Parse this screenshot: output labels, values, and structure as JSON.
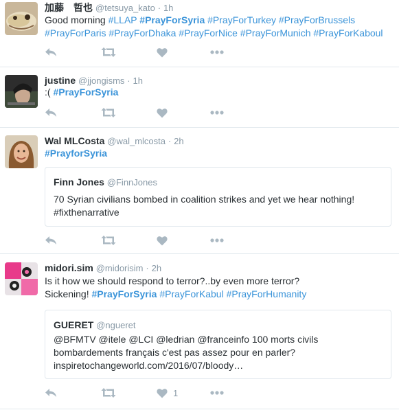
{
  "tweets": [
    {
      "name": "加藤　哲也",
      "handle": "@tetsuya_kato",
      "dot": "·",
      "time": "1h",
      "lines": [
        [
          {
            "t": "Good morning ",
            "k": "txt"
          },
          {
            "t": "#LLAP",
            "k": "tag"
          },
          {
            "t": " ",
            "k": "txt"
          },
          {
            "t": "#PrayForSyria",
            "k": "tagb"
          },
          {
            "t": " ",
            "k": "txt"
          },
          {
            "t": "#PrayForTurkey",
            "k": "tag"
          },
          {
            "t": " ",
            "k": "txt"
          },
          {
            "t": "#PrayForBrussels",
            "k": "tag"
          }
        ],
        [
          {
            "t": "#PrayForParis",
            "k": "tag"
          },
          {
            "t": " ",
            "k": "txt"
          },
          {
            "t": "#PrayForDhaka",
            "k": "tag"
          },
          {
            "t": " ",
            "k": "txt"
          },
          {
            "t": "#PrayForNice",
            "k": "tag"
          },
          {
            "t": " ",
            "k": "txt"
          },
          {
            "t": "#PrayForMunich",
            "k": "tag"
          },
          {
            "t": " ",
            "k": "txt"
          },
          {
            "t": "#PrayForKaboul",
            "k": "tag"
          }
        ]
      ],
      "like_count": ""
    },
    {
      "name": "justine",
      "handle": "@jjongisms",
      "dot": "·",
      "time": "1h",
      "lines": [
        [
          {
            "t": ":( ",
            "k": "txt"
          },
          {
            "t": "#PrayForSyria",
            "k": "tagb"
          }
        ]
      ],
      "like_count": ""
    },
    {
      "name": "Wal MLCosta",
      "handle": "@wal_mlcosta",
      "dot": "·",
      "time": "2h",
      "lines": [
        [
          {
            "t": "#PrayforSyria",
            "k": "tagb"
          }
        ]
      ],
      "quote": {
        "name": "Finn Jones",
        "handle": "@FinnJones",
        "lines": [
          "70 Syrian civilians bombed in coalition strikes and yet we hear nothing!",
          "#fixthenarrative"
        ]
      },
      "like_count": ""
    },
    {
      "name": "midori.sim",
      "handle": "@midorisim",
      "dot": "·",
      "time": "2h",
      "lines": [
        [
          {
            "t": "Is it how we should respond to terror?..by even more terror?",
            "k": "txt"
          }
        ],
        [
          {
            "t": "Sickening! ",
            "k": "txt"
          },
          {
            "t": "#PrayForSyria",
            "k": "tagb"
          },
          {
            "t": " ",
            "k": "txt"
          },
          {
            "t": "#PrayForKabul",
            "k": "tag"
          },
          {
            "t": " ",
            "k": "txt"
          },
          {
            "t": "#PrayForHumanity",
            "k": "tag"
          }
        ]
      ],
      "quote": {
        "name": "GUERET",
        "handle": "@ngueret",
        "lines": [
          "@BFMTV @itele @LCI @ledrian @franceinfo 100 morts civils",
          "bombardements français  c'est pas assez pour en parler?",
          "inspiretochangeworld.com/2016/07/bloody…"
        ]
      },
      "like_count": "1"
    }
  ],
  "colors": {
    "text": "#292f33",
    "muted": "#8899a6",
    "hashtag": "#3b94d9",
    "icon": "#aab8c2",
    "border": "#e1e8ed"
  },
  "icons": [
    "reply-icon",
    "retweet-icon",
    "like-icon",
    "more-icon"
  ]
}
